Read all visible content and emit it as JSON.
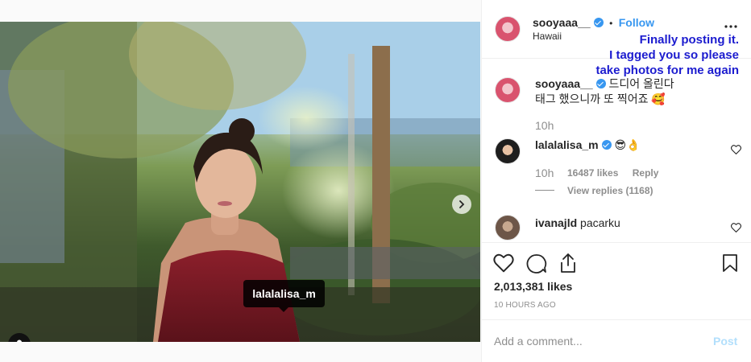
{
  "post": {
    "author": "sooyaaa__",
    "follow_label": "Follow",
    "separator": "•",
    "location": "Hawaii",
    "overlay_caption": [
      "Finally posting it.",
      "I tagged you so please",
      "take photos for me again"
    ],
    "tagged_user": "lalalalisa_m",
    "carousel": {
      "count": 2,
      "active": 1
    }
  },
  "caption": {
    "author": "sooyaaa__",
    "line1": "드디어 올린다",
    "line2": "태그 했으니까 또 찍어죠 🥰",
    "time": "10h"
  },
  "comments": [
    {
      "author": "lalalalisa_m",
      "text": "😎👌",
      "time": "10h",
      "likes": "16487 likes",
      "reply_label": "Reply",
      "view_replies": "View replies (1168)"
    },
    {
      "author": "ivanajld",
      "text": "pacarku"
    }
  ],
  "engagement": {
    "likes": "2,013,381 likes",
    "time_ago": "10 HOURS AGO"
  },
  "comment_box": {
    "placeholder": "Add a comment...",
    "post_label": "Post"
  },
  "colors": {
    "link_blue": "#3897f0",
    "overlay_text": "#1c1ccf",
    "post_disabled": "#b2dffc"
  },
  "icons": [
    "chevron-right-icon",
    "user-icon",
    "more-icon",
    "heart-icon",
    "comment-icon",
    "share-icon",
    "bookmark-icon",
    "verified-icon"
  ]
}
